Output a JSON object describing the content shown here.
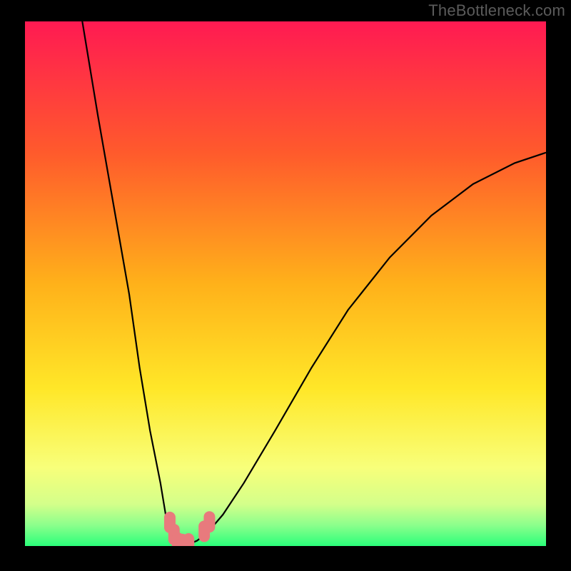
{
  "watermark": "TheBottleneck.com",
  "chart_data": {
    "type": "line",
    "title": "",
    "xlabel": "",
    "ylabel": "",
    "xlim": [
      0,
      100
    ],
    "ylim": [
      0,
      100
    ],
    "grid": false,
    "legend": false,
    "background_gradient": {
      "stops": [
        {
          "y": 0,
          "color": "#ff1a52"
        },
        {
          "y": 25,
          "color": "#ff5a2c"
        },
        {
          "y": 50,
          "color": "#ffb11a"
        },
        {
          "y": 70,
          "color": "#ffe728"
        },
        {
          "y": 85,
          "color": "#f8ff7a"
        },
        {
          "y": 92,
          "color": "#d4ff8a"
        },
        {
          "y": 96,
          "color": "#8cff8c"
        },
        {
          "y": 100,
          "color": "#2bff7a"
        }
      ]
    },
    "series": [
      {
        "name": "bottleneck-curve",
        "color": "#000000",
        "x": [
          11,
          14,
          17,
          20,
          22,
          24,
          26,
          27,
          28,
          29,
          29.5,
          30,
          31,
          33,
          35,
          38,
          42,
          48,
          55,
          62,
          70,
          78,
          86,
          94,
          100
        ],
        "y": [
          100,
          82,
          65,
          48,
          34,
          22,
          12,
          6,
          2,
          0.5,
          0,
          0,
          0.2,
          1,
          2.5,
          6,
          12,
          22,
          34,
          45,
          55,
          63,
          69,
          73,
          75
        ]
      }
    ],
    "ideal_markers": {
      "color": "#e87a7d",
      "points": [
        {
          "x": 27.8,
          "y": 4.5
        },
        {
          "x": 28.6,
          "y": 2.2
        },
        {
          "x": 29.3,
          "y": 0.6
        },
        {
          "x": 30.2,
          "y": 0.3
        },
        {
          "x": 31.4,
          "y": 0.4
        },
        {
          "x": 34.4,
          "y": 2.8
        },
        {
          "x": 35.4,
          "y": 4.6
        }
      ]
    }
  }
}
